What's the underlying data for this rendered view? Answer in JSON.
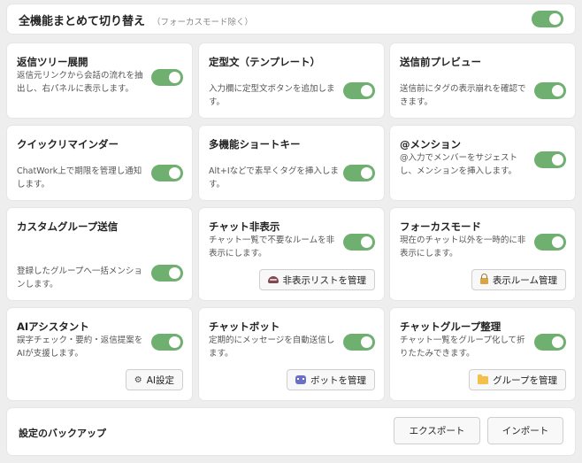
{
  "master": {
    "title": "全機能まとめて切り替え",
    "subtitle": "（フォーカスモード除く）",
    "enabled": true
  },
  "cards": [
    {
      "title": "返信ツリー展開",
      "desc": "返信元リンクから会話の流れを抽出し、右パネルに表示します。",
      "enabled": true
    },
    {
      "title": "定型文（テンプレート）",
      "desc": "入力欄に定型文ボタンを追加します。",
      "enabled": true
    },
    {
      "title": "送信前プレビュー",
      "desc": "送信前にタグの表示崩れを確認できます。",
      "enabled": true
    },
    {
      "title": "クイックリマインダー",
      "desc": "ChatWork上で期限を管理し通知します。",
      "enabled": true
    },
    {
      "title": "多機能ショートキー",
      "desc": "Alt+Iなどで素早くタグを挿入します。",
      "enabled": true
    },
    {
      "title": "@メンション",
      "desc": "@入力でメンバーをサジェストし、メンションを挿入します。",
      "enabled": true
    },
    {
      "title": "カスタムグループ送信",
      "desc": "登録したグループへ一括メンションします。",
      "enabled": true
    },
    {
      "title": "チャット非表示",
      "desc": "チャット一覧で不要なルームを非表示にします。",
      "enabled": true,
      "button": "非表示リストを管理",
      "icon": "spy-icon"
    },
    {
      "title": "フォーカスモード",
      "desc": "現在のチャット以外を一時的に非表示にします。",
      "enabled": true,
      "button": "表示ルーム管理",
      "icon": "lock-icon"
    },
    {
      "title": "AIアシスタント",
      "desc": "誤字チェック・要約・返信提案をAIが支援します。",
      "enabled": true,
      "button": "AI設定",
      "icon": "gear-icon"
    },
    {
      "title": "チャットボット",
      "desc": "定期的にメッセージを自動送信します。",
      "enabled": true,
      "button": "ボットを管理",
      "icon": "robot-icon"
    },
    {
      "title": "チャットグループ整理",
      "desc": "チャット一覧をグループ化して折りたたみできます。",
      "enabled": true,
      "button": "グループを管理",
      "icon": "folder-icon"
    }
  ],
  "backup": {
    "title": "設定のバックアップ",
    "export_label": "エクスポート",
    "import_label": "インポート"
  },
  "colors": {
    "toggle_on": "#6fb071",
    "panel_bg": "#ffffff",
    "page_bg": "#eeeeee"
  }
}
